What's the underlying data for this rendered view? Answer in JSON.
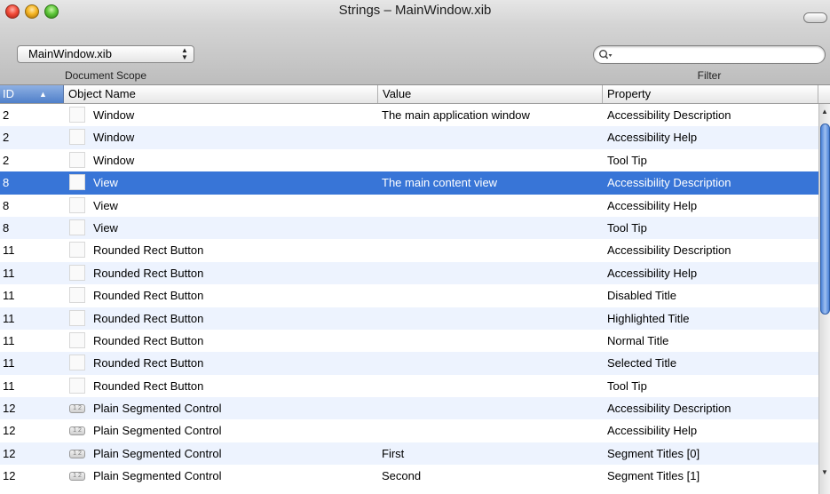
{
  "window": {
    "title": "Strings – MainWindow.xib"
  },
  "toolbar": {
    "scope_value": "MainWindow.xib",
    "scope_label": "Document Scope",
    "filter_value": "",
    "filter_placeholder": "",
    "filter_label": "Filter"
  },
  "table": {
    "columns": {
      "id": "ID",
      "object_name": "Object Name",
      "value": "Value",
      "property": "Property"
    },
    "sort_indicator": "▲",
    "selected_row_index": 3,
    "rows": [
      {
        "id": "2",
        "icon": "blank-icon",
        "name": "Window",
        "value": "The main application window",
        "property": "Accessibility Description"
      },
      {
        "id": "2",
        "icon": "blank-icon",
        "name": "Window",
        "value": "",
        "property": "Accessibility Help"
      },
      {
        "id": "2",
        "icon": "blank-icon",
        "name": "Window",
        "value": "",
        "property": "Tool Tip"
      },
      {
        "id": "8",
        "icon": "blank-icon",
        "name": "View",
        "value": "The main content view",
        "property": "Accessibility Description"
      },
      {
        "id": "8",
        "icon": "blank-icon",
        "name": "View",
        "value": "",
        "property": "Accessibility Help"
      },
      {
        "id": "8",
        "icon": "blank-icon",
        "name": "View",
        "value": "",
        "property": "Tool Tip"
      },
      {
        "id": "11",
        "icon": "blank-icon",
        "name": "Rounded Rect Button",
        "value": "",
        "property": "Accessibility Description"
      },
      {
        "id": "11",
        "icon": "blank-icon",
        "name": "Rounded Rect Button",
        "value": "",
        "property": "Accessibility Help"
      },
      {
        "id": "11",
        "icon": "blank-icon",
        "name": "Rounded Rect Button",
        "value": "",
        "property": "Disabled Title"
      },
      {
        "id": "11",
        "icon": "blank-icon",
        "name": "Rounded Rect Button",
        "value": "",
        "property": "Highlighted Title"
      },
      {
        "id": "11",
        "icon": "blank-icon",
        "name": "Rounded Rect Button",
        "value": "",
        "property": "Normal Title"
      },
      {
        "id": "11",
        "icon": "blank-icon",
        "name": "Rounded Rect Button",
        "value": "",
        "property": "Selected Title"
      },
      {
        "id": "11",
        "icon": "blank-icon",
        "name": "Rounded Rect Button",
        "value": "",
        "property": "Tool Tip"
      },
      {
        "id": "12",
        "icon": "segmented-control-icon",
        "name": "Plain Segmented Control",
        "value": "",
        "property": "Accessibility Description"
      },
      {
        "id": "12",
        "icon": "segmented-control-icon",
        "name": "Plain Segmented Control",
        "value": "",
        "property": "Accessibility Help"
      },
      {
        "id": "12",
        "icon": "segmented-control-icon",
        "name": "Plain Segmented Control",
        "value": "First",
        "property": "Segment Titles [0]"
      },
      {
        "id": "12",
        "icon": "segmented-control-icon",
        "name": "Plain Segmented Control",
        "value": "Second",
        "property": "Segment Titles [1]"
      }
    ]
  },
  "icons": {
    "segmented_glyph": "1 2",
    "select_arrows": "▲▼",
    "scroll_up": "▲",
    "scroll_down": "▼"
  },
  "colors": {
    "selection": "#3875d7",
    "alt_row": "#edf3fe",
    "sorted_header": "#4f7fc9"
  }
}
